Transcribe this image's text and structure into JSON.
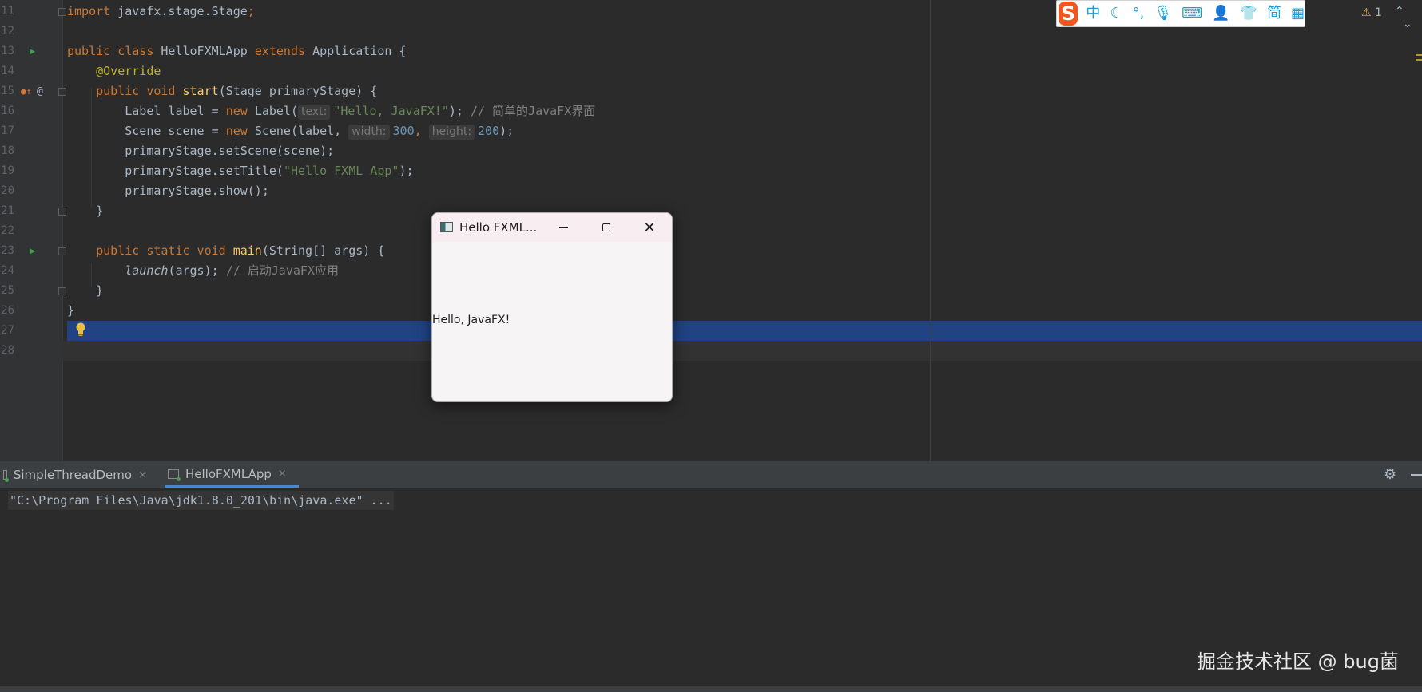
{
  "editor": {
    "lines": [
      {
        "n": "11",
        "parts": [
          [
            "kw",
            "import "
          ],
          [
            "",
            "javafx.stage.Stage"
          ],
          [
            "kw",
            ";"
          ]
        ]
      },
      {
        "n": "12",
        "parts": []
      },
      {
        "n": "13",
        "run": true,
        "parts": [
          [
            "kw",
            "public class "
          ],
          [
            "",
            "HelloFXMLApp "
          ],
          [
            "kw",
            "extends "
          ],
          [
            "",
            "Application {"
          ]
        ]
      },
      {
        "n": "14",
        "parts": [
          [
            "",
            "    "
          ],
          [
            "ann",
            "@Override"
          ]
        ]
      },
      {
        "n": "15",
        "override": true,
        "parts": [
          [
            "",
            "    "
          ],
          [
            "kw",
            "public void "
          ],
          [
            "fn",
            "start"
          ],
          [
            "",
            "(Stage primaryStage) {"
          ]
        ]
      },
      {
        "n": "16",
        "parts": [
          [
            "",
            "        Label label = "
          ],
          [
            "kw",
            "new "
          ],
          [
            "",
            "Label("
          ],
          [
            "hint",
            "text:"
          ],
          [
            "str",
            "\"Hello, JavaFX!\""
          ],
          [
            "",
            "); "
          ],
          [
            "cm",
            "// 简单的JavaFX界面"
          ]
        ]
      },
      {
        "n": "17",
        "parts": [
          [
            "",
            "        Scene scene = "
          ],
          [
            "kw",
            "new "
          ],
          [
            "",
            "Scene(label, "
          ],
          [
            "hint",
            "width:"
          ],
          [
            "num",
            "300"
          ],
          [
            "kw",
            ", "
          ],
          [
            "hint",
            "height:"
          ],
          [
            "num",
            "200"
          ],
          [
            "",
            "); "
          ]
        ]
      },
      {
        "n": "18",
        "parts": [
          [
            "",
            "        primaryStage.setScene(scene);"
          ]
        ]
      },
      {
        "n": "19",
        "parts": [
          [
            "",
            "        primaryStage.setTitle("
          ],
          [
            "str",
            "\"Hello FXML App\""
          ],
          [
            "",
            ");"
          ]
        ]
      },
      {
        "n": "20",
        "parts": [
          [
            "",
            "        primaryStage.show();"
          ]
        ]
      },
      {
        "n": "21",
        "parts": [
          [
            "",
            "    }"
          ]
        ]
      },
      {
        "n": "22",
        "parts": []
      },
      {
        "n": "23",
        "run": true,
        "parts": [
          [
            "",
            "    "
          ],
          [
            "kw",
            "public static void "
          ],
          [
            "fn",
            "main"
          ],
          [
            "",
            "(String[] args) {"
          ]
        ]
      },
      {
        "n": "24",
        "parts": [
          [
            "",
            "        "
          ],
          [
            "it",
            "launch"
          ],
          [
            "",
            "(args); "
          ],
          [
            "cm",
            "// 启动JavaFX应用"
          ]
        ]
      },
      {
        "n": "25",
        "parts": [
          [
            "",
            "    }"
          ]
        ]
      },
      {
        "n": "26",
        "parts": [
          [
            "",
            "}"
          ]
        ]
      },
      {
        "n": "27",
        "bulb": true,
        "parts": []
      },
      {
        "n": "28",
        "parts": []
      }
    ],
    "override_icon": "@",
    "bulb_icon": "lightbulb-icon",
    "warning_count": "1",
    "warning_icon": "⚠",
    "nav_up": "⌃",
    "nav_down": "⌄"
  },
  "ime": {
    "logo": "S",
    "items": [
      "中",
      "☾",
      "°,",
      "🎙",
      "⌨",
      "👤",
      "👕",
      "简",
      "▦"
    ]
  },
  "fx_window": {
    "title": "Hello FXML...",
    "close_glyph": "✕",
    "label": "Hello, JavaFX!"
  },
  "run_panel": {
    "tabs": [
      {
        "label": "SimpleThreadDemo",
        "close": "×"
      },
      {
        "label": "HelloFXMLApp",
        "close": "×"
      }
    ],
    "gear": "⚙",
    "console_line": "\"C:\\Program Files\\Java\\jdk1.8.0_201\\bin\\java.exe\" ..."
  },
  "watermark": "掘金技术社区 @ bug菌",
  "colors": {
    "editor_bg": "#2b2b2b",
    "selection": "#214283",
    "keyword": "#cc7832",
    "string": "#6a8759",
    "number": "#6897bb",
    "comment": "#808080",
    "run_icon": "#499c54"
  }
}
